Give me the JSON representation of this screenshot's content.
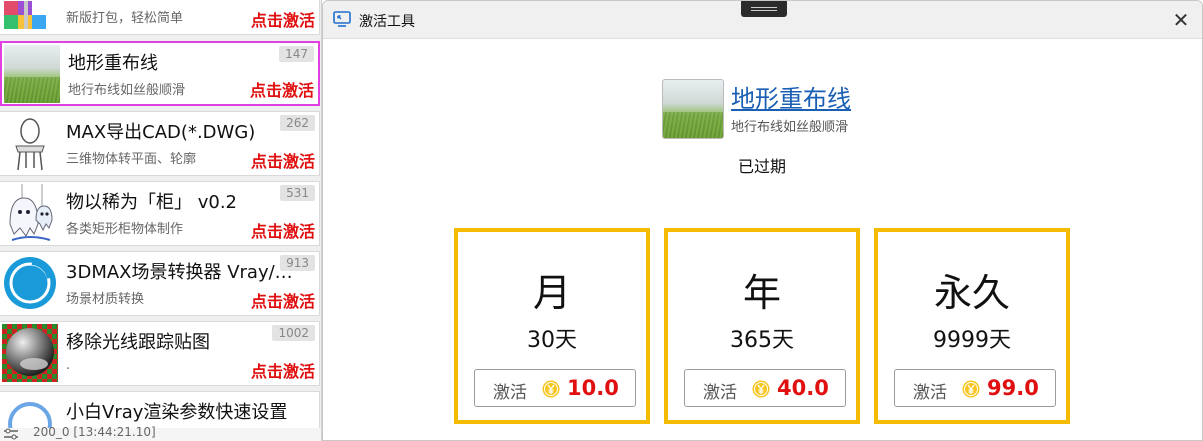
{
  "left_list": {
    "items": [
      {
        "title": "",
        "desc": "新版打包，轻松简单",
        "count": "",
        "activate": "点击激活"
      },
      {
        "title": "地形重布线",
        "desc": "地行布线如丝般顺滑",
        "count": "147",
        "activate": "点击激活"
      },
      {
        "title": "MAX导出CAD(*.DWG)",
        "desc": "三维物体转平面、轮廓",
        "count": "262",
        "activate": "点击激活"
      },
      {
        "title": "物以稀为「柜」 v0.2",
        "desc": "各类矩形柜物体制作",
        "count": "531",
        "activate": "点击激活"
      },
      {
        "title": "3DMAX场景转换器 Vray/…",
        "desc": "场景材质转换",
        "count": "913",
        "activate": "点击激活"
      },
      {
        "title": "移除光线跟踪贴图",
        "desc": ".",
        "count": "1002",
        "activate": "点击激活"
      },
      {
        "title": "小白Vray渲染参数快速设置",
        "desc": "",
        "count": "",
        "activate": ""
      }
    ],
    "footer_status": "200_0 [13:44:21.10]"
  },
  "dialog": {
    "title": "激活工具",
    "close_label": "✕",
    "product": {
      "name": "地形重布线",
      "subtitle": "地行布线如丝般顺滑",
      "status": "已过期"
    },
    "plans": [
      {
        "name": "月",
        "days": "30天",
        "button": "激活",
        "price": "10.0"
      },
      {
        "name": "年",
        "days": "365天",
        "button": "激活",
        "price": "40.0"
      },
      {
        "name": "永久",
        "days": "9999天",
        "button": "激活",
        "price": "99.0"
      }
    ]
  },
  "colors": {
    "accent_border": "#f5bb00",
    "price_red": "#e01010",
    "selection": "#e040e0",
    "link": "#1a5fb4"
  }
}
